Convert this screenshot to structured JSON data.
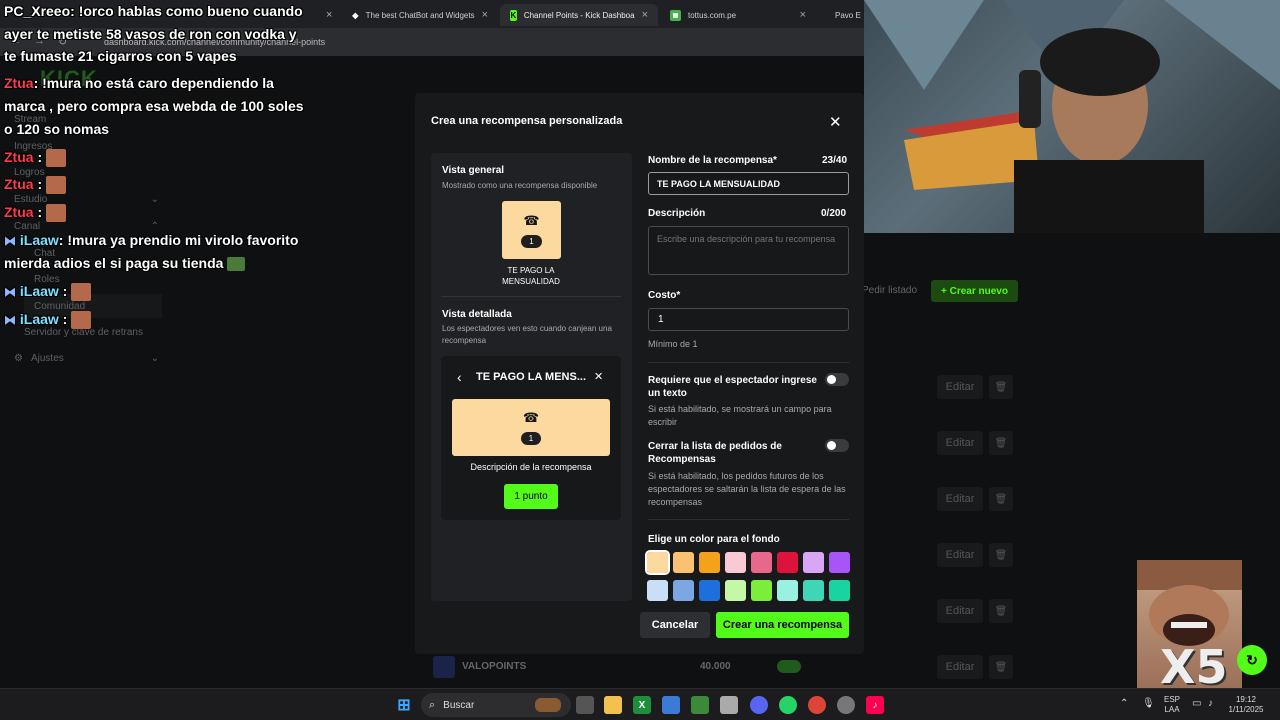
{
  "browser": {
    "tabs": [
      {
        "label": "PC_Xreeo",
        "close": "×"
      },
      {
        "label": "The best ChatBot and Widgets",
        "close": "×"
      },
      {
        "label": "Channel Points - Kick Dashboa",
        "close": "×"
      },
      {
        "label": "tottus.com.pe",
        "close": "×"
      },
      {
        "label": "Pavo E",
        "close": ""
      }
    ],
    "url": "dashboard.kick.com/channel/community/channel-points"
  },
  "sidebar": {
    "logo": "KICK",
    "items": [
      "Stream",
      "Ingresos",
      "Logros",
      "Estudio",
      "Canal",
      "Chat",
      "Roles",
      "Comunidad",
      "Servidor y clave de retrans",
      "Ajustes"
    ]
  },
  "chat": [
    {
      "user": "PC_Xreeo",
      "text": ": !orco hablas como bueno cuando"
    },
    {
      "user": "",
      "text": "ayer te metiste 58 vasos de ron con vodka y"
    },
    {
      "user": "",
      "text": "te fumaste 21 cigarros con 5 vapes"
    },
    {
      "user": "Ztua",
      "text": ": !mura no está caro dependiendo la"
    },
    {
      "user": "",
      "text": "marca , pero compra esa webda de 100 soles"
    },
    {
      "user": "",
      "text": "o 120 so nomas"
    },
    {
      "user": "Ztua",
      "text": " :"
    },
    {
      "user": "Ztua",
      "text": " :"
    },
    {
      "user": "Ztua",
      "text": " :"
    },
    {
      "user": "iLaaw",
      "text": ": !mura ya prendio mi virolo favorito"
    },
    {
      "user": "",
      "text": "mierda adios el si paga su tienda"
    },
    {
      "user": "iLaaw",
      "text": " :"
    },
    {
      "user": "iLaaw",
      "text": " :"
    }
  ],
  "modal": {
    "title": "Crea una recompensa personalizada",
    "close": "✕",
    "overview": {
      "title": "Vista general",
      "subtitle": "Mostrado como una recompensa disponible",
      "count": "1",
      "reward_name": "TE PAGO LA MENSUALIDAD"
    },
    "detail": {
      "title": "Vista detallada",
      "subtitle": "Los espectadores ven esto cuando canjean una recompensa",
      "back": "‹",
      "header": "TE PAGO LA MENS...",
      "close": "✕",
      "count": "1",
      "description": "Descripción de la recompensa",
      "points_button": "1 punto"
    },
    "form": {
      "name_label": "Nombre de la recompensa*",
      "name_count": "23/40",
      "name_value": "TE PAGO LA MENSUALIDAD",
      "desc_label": "Descripción",
      "desc_count": "0/200",
      "desc_placeholder": "Escribe una descripción para tu recompensa",
      "cost_label": "Costo*",
      "cost_value": "1",
      "cost_hint": "Mínimo de 1",
      "require_text_label": "Requiere que el espectador ingrese un texto",
      "require_text_hint": "Si está habilitado, se mostrará un campo para escribir",
      "close_queue_label": "Cerrar la lista de pedidos de Recompensas",
      "close_queue_hint": "Si está habilitado, los pedidos futuros de los espectadores se saltarán la lista de espera de las recompensas",
      "color_label": "Elige un color para el fondo",
      "colors": [
        "#fcd99e",
        "#fbc173",
        "#f6a11b",
        "#f9c9d4",
        "#e8688c",
        "#dc143c",
        "#d9a6f6",
        "#a855f7",
        "#c7e0f7",
        "#7ba8e3",
        "#1e6fd9",
        "#c4f7a6",
        "#7bed3b",
        "#9af0e1",
        "#3ed6b5",
        "#18d4a0"
      ],
      "selected_color": "#fcd99e",
      "cancel": "Cancelar",
      "create": "Crear una recompensa"
    }
  },
  "background": {
    "request_list": "Pedir listado",
    "create_new": "+ Crear nuevo",
    "edit_label": "Editar",
    "trash": "🗑",
    "points_row": {
      "name": "VALOPOINTS",
      "cost": "40.000"
    }
  },
  "meme": {
    "text": "X5"
  },
  "taskbar": {
    "search": "Buscar",
    "lang_top": "ESP",
    "lang_bottom": "LAA",
    "time": "19:12",
    "date": "1/11/2025"
  },
  "colors": {
    "accent": "#53fc18",
    "modal_bg": "#18191b",
    "panel_bg": "#202124"
  }
}
